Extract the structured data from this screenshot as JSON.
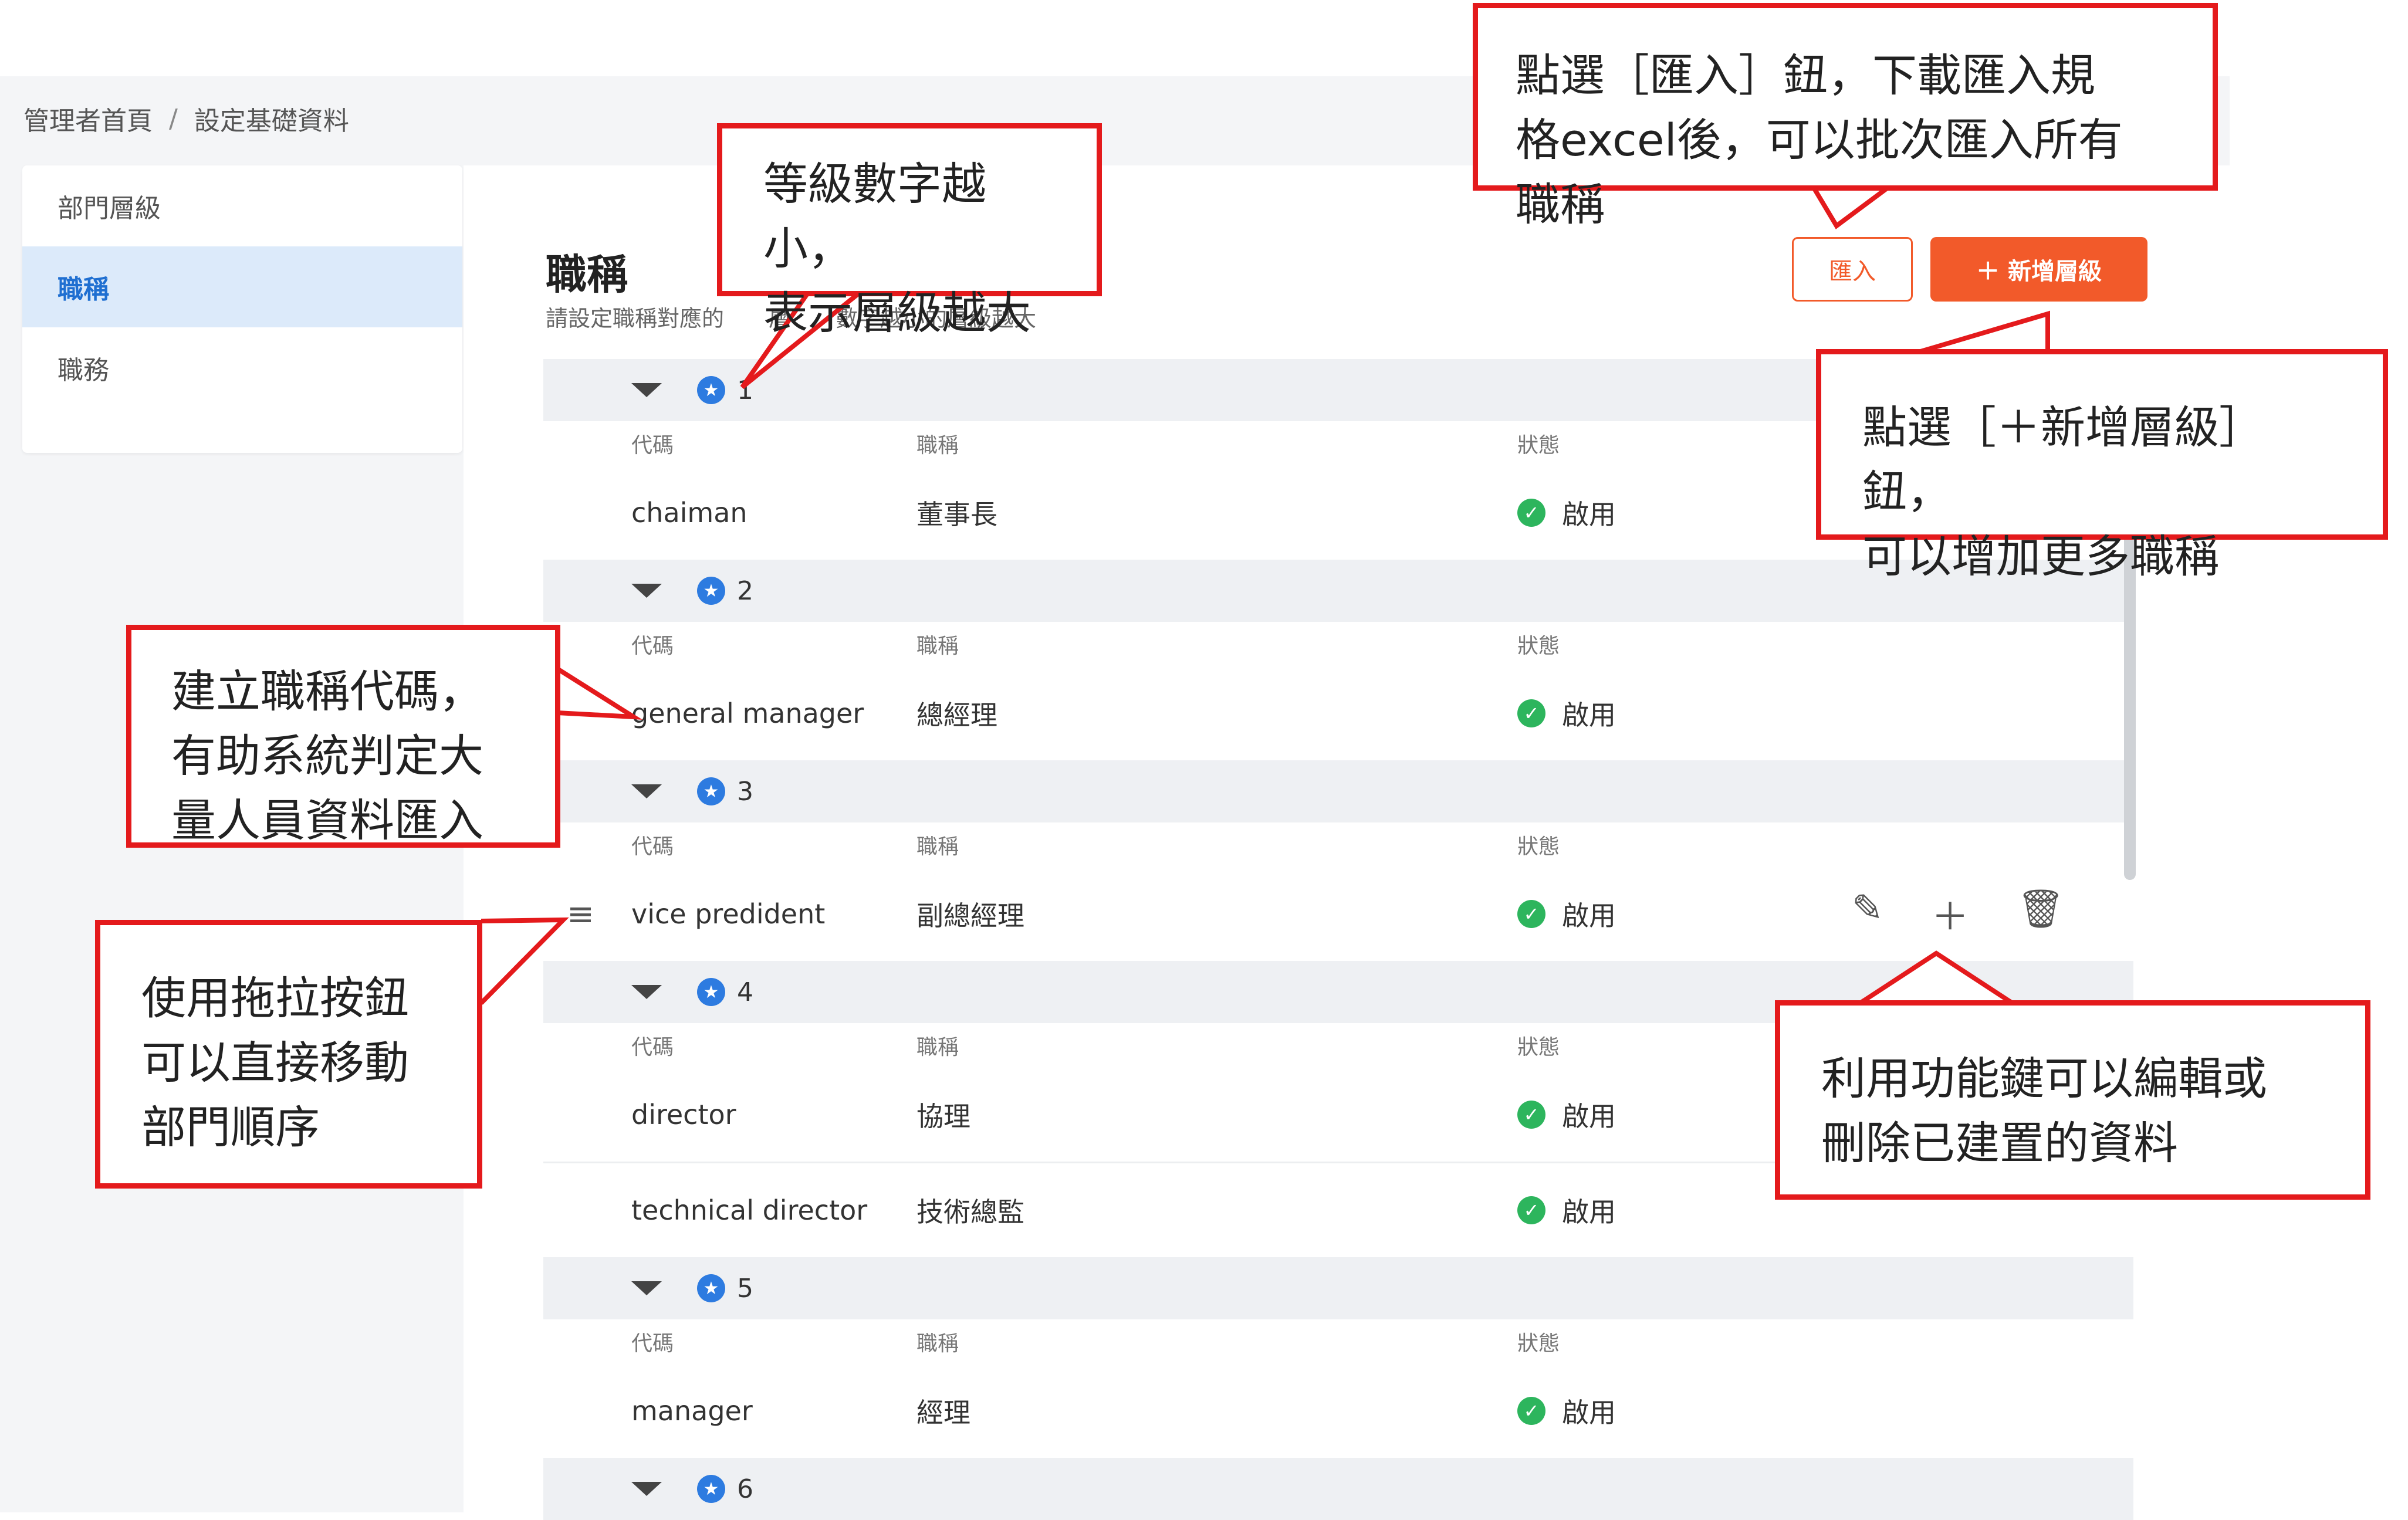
{
  "breadcrumb": {
    "home": "管理者首頁",
    "separator": "/",
    "current": "設定基礎資料"
  },
  "sidebar": {
    "items": [
      {
        "label": "部門層級"
      },
      {
        "label": "職稱"
      },
      {
        "label": "職務"
      }
    ]
  },
  "main": {
    "title": "職稱",
    "subtitle": "請設定職稱對應的　　層級，數字越小的層級越大",
    "import_label": "匯入",
    "add_label": "新增層級"
  },
  "columns": {
    "code": "代碼",
    "title": "職稱",
    "status": "狀態"
  },
  "groups": [
    {
      "level": "1",
      "rows": [
        {
          "code": "chaiman",
          "title": "董事長",
          "status": "啟用"
        }
      ]
    },
    {
      "level": "2",
      "rows": [
        {
          "code": "general manager",
          "title": "總經理",
          "status": "啟用"
        }
      ]
    },
    {
      "level": "3",
      "rows": [
        {
          "code": "vice predident",
          "title": "副總經理",
          "status": "啟用"
        }
      ]
    },
    {
      "level": "4",
      "rows": [
        {
          "code": "director",
          "title": "協理",
          "status": "啟用"
        },
        {
          "code": "technical director",
          "title": "技術總監",
          "status": "啟用"
        }
      ]
    },
    {
      "level": "5",
      "rows": [
        {
          "code": "manager",
          "title": "經理",
          "status": "啟用"
        }
      ]
    },
    {
      "level": "6",
      "rows": []
    }
  ],
  "callouts": {
    "level_note": "等級數字越小，\n表示層級越大",
    "import_note": "點選［匯入］鈕，下載匯入規\n格excel後，可以批次匯入所有\n職稱",
    "add_note": "點選［＋新增層級］鈕，\n可以增加更多職稱",
    "code_note": "建立職稱代碼，\n有助系統判定大\n量人員資料匯入",
    "drag_note": "使用拖拉按鈕\n可以直接移動\n部門順序",
    "action_note": "利用功能鍵可以編輯或\n刪除已建置的資料"
  },
  "colors": {
    "accent": "#f25a2a",
    "active_bg": "#dceafa",
    "active_text": "#1f6fd1",
    "callout_border": "#e41a1c",
    "status_ok": "#2db55d"
  }
}
